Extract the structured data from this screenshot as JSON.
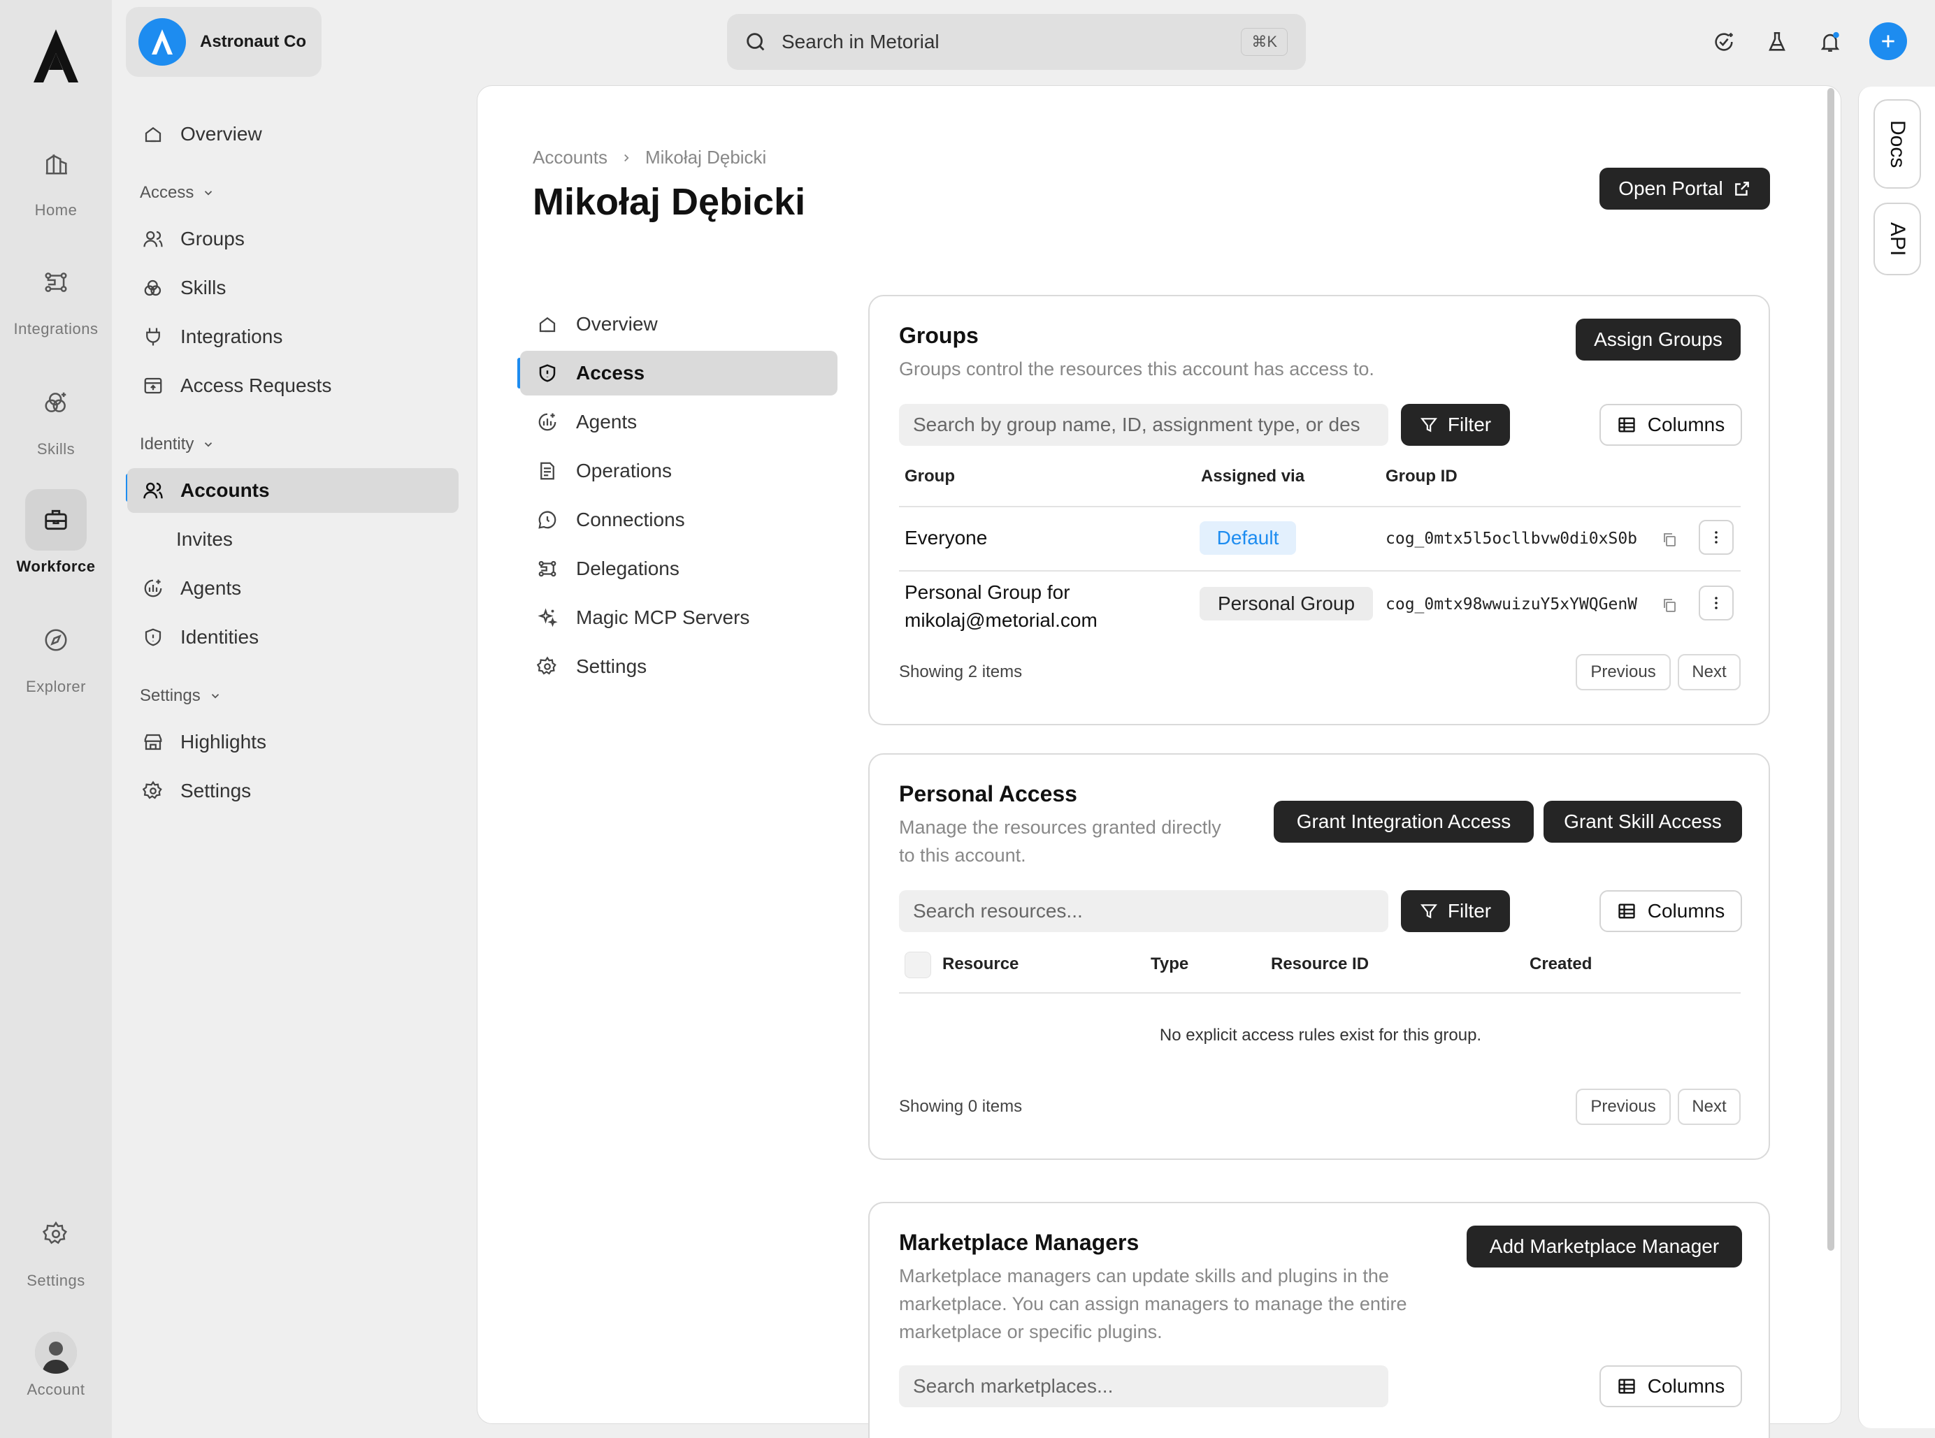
{
  "rail": {
    "items": [
      {
        "label": "Home",
        "icon": "home-icon"
      },
      {
        "label": "Integrations",
        "icon": "integrations-icon"
      },
      {
        "label": "Skills",
        "icon": "skills-icon"
      },
      {
        "label": "Workforce",
        "icon": "briefcase-icon",
        "active": true
      },
      {
        "label": "Explorer",
        "icon": "compass-icon"
      }
    ],
    "settings_label": "Settings",
    "account_label": "Account"
  },
  "org": {
    "name": "Astronaut Co"
  },
  "sidebar": {
    "overview": "Overview",
    "access_section": "Access",
    "access_items": [
      "Groups",
      "Skills",
      "Integrations",
      "Access Requests"
    ],
    "identity_section": "Identity",
    "accounts": "Accounts",
    "invites": "Invites",
    "agents": "Agents",
    "identities": "Identities",
    "settings_section": "Settings",
    "highlights": "Highlights",
    "settings": "Settings"
  },
  "topbar": {
    "search_placeholder": "Search in Metorial",
    "shortcut": "⌘K"
  },
  "right_tabs": {
    "docs": "Docs",
    "api": "API"
  },
  "page": {
    "breadcrumb": [
      "Accounts",
      "Mikołaj Dębicki"
    ],
    "title": "Mikołaj Dębicki",
    "open_portal": "Open Portal"
  },
  "subnav": {
    "items": [
      "Overview",
      "Access",
      "Agents",
      "Operations",
      "Connections",
      "Delegations",
      "Magic MCP Servers",
      "Settings"
    ],
    "active": "Access"
  },
  "groups_card": {
    "title": "Groups",
    "description": "Groups control the resources this account has access to.",
    "assign_button": "Assign Groups",
    "search_placeholder": "Search by group name, ID, assignment type, or des",
    "filter": "Filter",
    "columns": "Columns",
    "headers": [
      "Group",
      "Assigned via",
      "Group ID"
    ],
    "rows": [
      {
        "group": "Everyone",
        "via": "Default",
        "id": "cog_0mtx5l5ocllbvw0di0xS0b"
      },
      {
        "group_line1": "Personal Group for",
        "group_line2": "mikolaj@metorial.com",
        "via": "Personal Group",
        "id": "cog_0mtx98wwuizuY5xYWQGenW"
      }
    ],
    "showing": "Showing 2 items",
    "previous": "Previous",
    "next": "Next"
  },
  "personal_card": {
    "title": "Personal Access",
    "description_line1": "Manage the resources granted directly",
    "description_line2": "to this account.",
    "grant_integration": "Grant Integration Access",
    "grant_skill": "Grant Skill Access",
    "search_placeholder": "Search resources...",
    "filter": "Filter",
    "columns": "Columns",
    "headers": [
      "Resource",
      "Type",
      "Resource ID",
      "Created"
    ],
    "empty": "No explicit access rules exist for this group.",
    "showing": "Showing 0 items",
    "previous": "Previous",
    "next": "Next"
  },
  "marketplace_card": {
    "title": "Marketplace Managers",
    "description_line1": "Marketplace managers can update skills and plugins in the",
    "description_line2": "marketplace. You can assign managers to manage the entire",
    "description_line3": "marketplace or specific plugins.",
    "add_button": "Add Marketplace Manager",
    "search_placeholder": "Search marketplaces...",
    "columns": "Columns"
  },
  "colors": {
    "accent": "#1d8cf0",
    "dark_button": "#252525",
    "default_badge_bg": "#e3f0fd",
    "personal_badge_bg": "#ececec"
  }
}
